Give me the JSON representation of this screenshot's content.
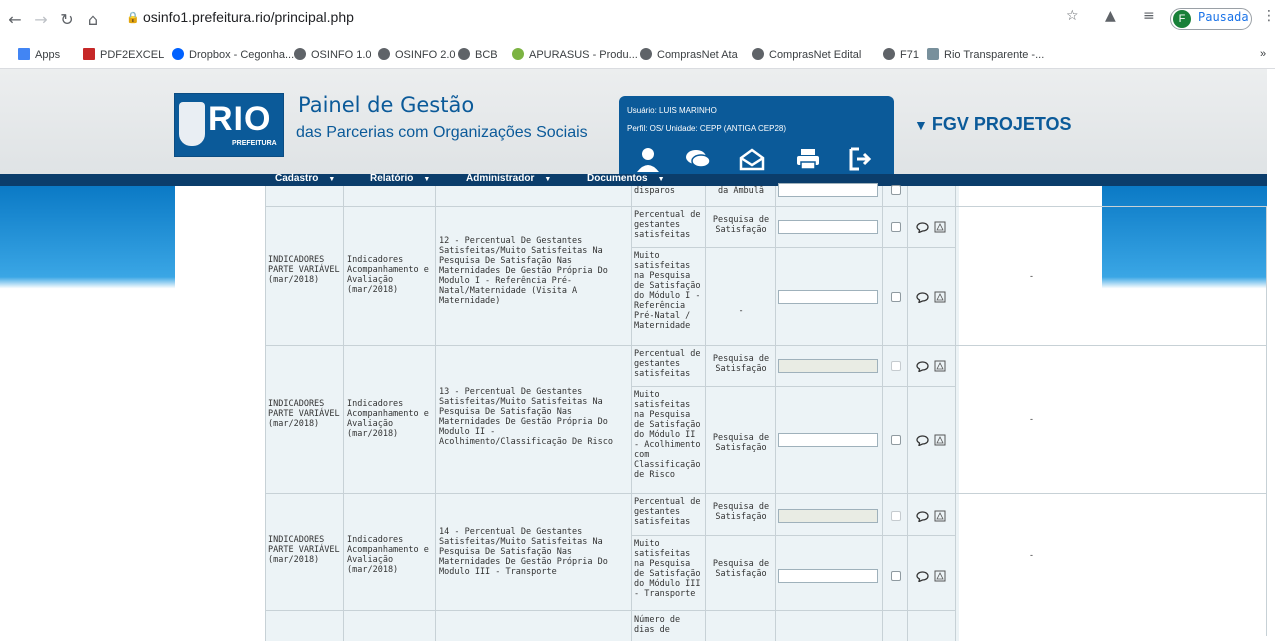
{
  "browser": {
    "url": "osinfo1.prefeitura.rio/principal.php",
    "profile_initial": "F",
    "profile_status": "Pausada"
  },
  "bookmarks": [
    "Apps",
    "PDF2EXCEL",
    "Dropbox - Cegonha...",
    "OSINFO 1.0",
    "OSINFO 2.0",
    "BCB",
    "APURASUS - Produ...",
    "ComprasNet Ata",
    "ComprasNet Edital",
    "F71",
    "Rio Transparente -..."
  ],
  "header": {
    "logo_text": "RIO",
    "logo_sub": "PREFEITURA",
    "title_line1": "Painel de Gestão",
    "title_line2": "das Parcerias com Organizações Sociais",
    "user_line": "Usuário: LUIS MARINHO",
    "profile_line": "Perfil: OS/ Unidade: CEPP (ANTIGA CEP28)",
    "partner_logo": "FGV PROJETOS"
  },
  "menu": [
    "Cadastro",
    "Relatório",
    "Administrador",
    "Documentos"
  ],
  "table": {
    "partial_top": {
      "indicator": "disparos",
      "meio": "da Ambulâ"
    },
    "groups": [
      {
        "tipo": "INDICADORES PARTE VARIÁVEL (mar/2018)",
        "categoria": "Indicadores Acompanhamento e Avaliação (mar/2018)",
        "descricao": "12 - Percentual De Gestantes Satisfeitas/Muito Satisfeitas Na Pesquisa De Satisfação Nas Maternidades De Gestão Própria Do Modulo I - Referência Pré-Natal/Maternidade (Visita A Maternidade)",
        "rows": [
          {
            "indicador": "Percentual de gestantes satisfeitas",
            "fonte": "Pesquisa de Satisfação"
          },
          {
            "indicador": "Muito satisfeitas na Pesquisa de Satisfação do Módulo I - Referência Pré-Natal / Maternidade",
            "fonte": "-"
          }
        ],
        "obs": "-"
      },
      {
        "tipo": "INDICADORES PARTE VARIÁVEL (mar/2018)",
        "categoria": "Indicadores Acompanhamento e Avaliação (mar/2018)",
        "descricao": "13 - Percentual De Gestantes Satisfeitas/Muito Satisfeitas Na Pesquisa De Satisfação Nas Maternidades De Gestão Própria Do Modulo II - Acolhimento/Classificação De Risco",
        "rows": [
          {
            "indicador": "Percentual de gestantes satisfeitas",
            "fonte": "Pesquisa de Satisfação"
          },
          {
            "indicador": "Muito satisfeitas na Pesquisa de Satisfação do Módulo II - Acolhimento com Classificação de Risco",
            "fonte": "Pesquisa de Satisfação"
          }
        ],
        "obs": "-"
      },
      {
        "tipo": "INDICADORES PARTE VARIÁVEL (mar/2018)",
        "categoria": "Indicadores Acompanhamento e Avaliação (mar/2018)",
        "descricao": "14 - Percentual De Gestantes Satisfeitas/Muito Satisfeitas Na Pesquisa De Satisfação Nas Maternidades De Gestão Própria Do Modulo III - Transporte",
        "rows": [
          {
            "indicador": "Percentual de gestantes satisfeitas",
            "fonte": "Pesquisa de Satisfação"
          },
          {
            "indicador": "Muito satisfeitas na Pesquisa de Satisfação do Módulo III - Transporte",
            "fonte": "Pesquisa de Satisfação"
          }
        ],
        "obs": "-"
      }
    ],
    "partial_bottom": {
      "indicator": "Número de dias de"
    }
  }
}
